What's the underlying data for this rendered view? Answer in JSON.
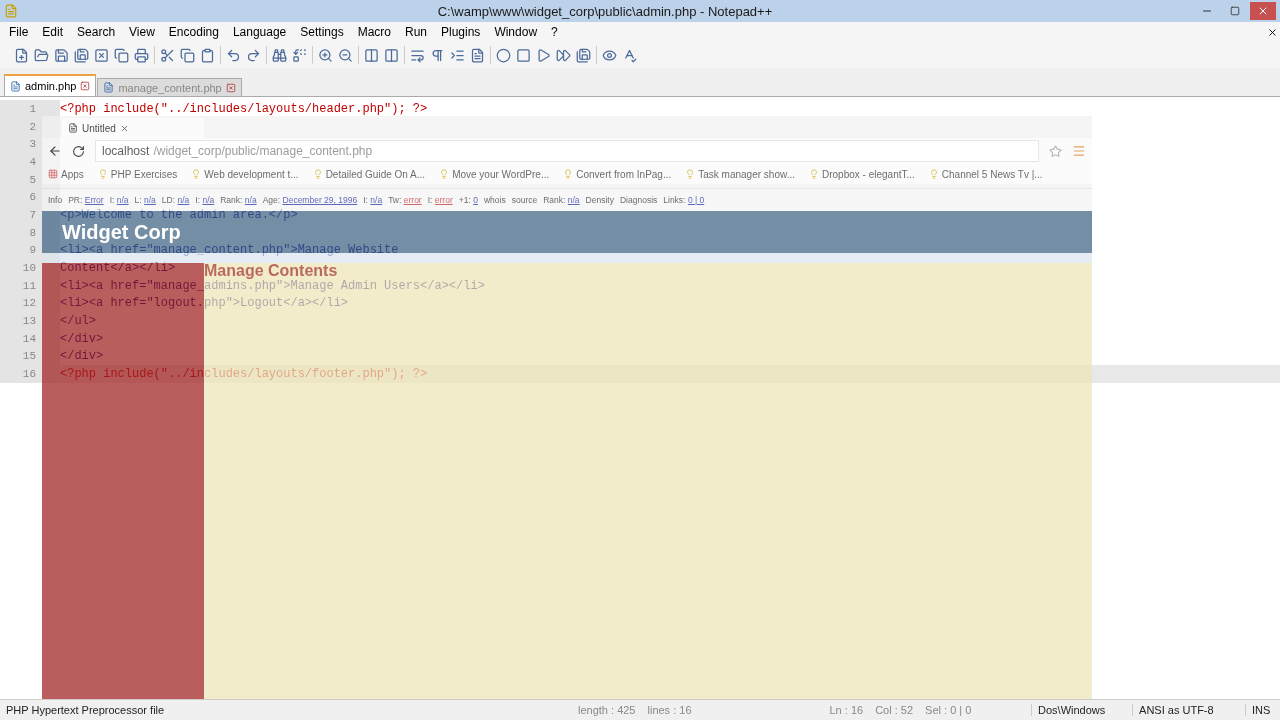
{
  "window": {
    "title": "C:\\wamp\\www\\widget_corp\\public\\admin.php - Notepad++"
  },
  "menu": [
    "File",
    "Edit",
    "Search",
    "View",
    "Encoding",
    "Language",
    "Settings",
    "Macro",
    "Run",
    "Plugins",
    "Window",
    "?"
  ],
  "tabs": [
    {
      "label": "admin.php",
      "selected": true
    },
    {
      "label": "manage_content.php",
      "selected": false
    }
  ],
  "editor": {
    "lines": [
      {
        "number": "1",
        "text": "<?php include(\"../includes/layouts/header.php\"); ?>",
        "kind": "php",
        "current": false
      },
      {
        "number": "2",
        "current": false
      },
      {
        "number": "3",
        "current": false
      },
      {
        "number": "4",
        "current": false
      },
      {
        "number": "5",
        "current": false
      },
      {
        "number": "6",
        "current": false
      },
      {
        "number": "7",
        "text": "<p>Welcome to the admin area.</p>",
        "kind": "html",
        "current": false
      },
      {
        "number": "8",
        "current": false
      },
      {
        "number": "9",
        "text": "<li><a href=\"manage_content.php\">Manage Website",
        "kind": "html",
        "current": false
      },
      {
        "number": "10",
        "text": "Content</a></li>",
        "kind": "html",
        "current": false
      },
      {
        "number": "11",
        "text": "<li><a href=\"manage_admins.php\">Manage Admin Users</a></li>",
        "kind": "html",
        "current": false
      },
      {
        "number": "12",
        "text": "<li><a href=\"logout.php\">Logout</a></li>",
        "kind": "html",
        "current": false
      },
      {
        "number": "13",
        "text": "</ul>",
        "kind": "html",
        "current": false
      },
      {
        "number": "14",
        "text": "</div>",
        "kind": "html",
        "current": false
      },
      {
        "number": "15",
        "text": "</div>",
        "kind": "html",
        "current": false
      },
      {
        "number": "16",
        "text": "<?php include(\"../includes/layouts/footer.php\"); ?>",
        "kind": "php",
        "current": true
      }
    ]
  },
  "browser": {
    "tab": "Untitled",
    "address_host": "localhost",
    "address_path": "/widget_corp/public/manage_content.php",
    "bookmarks": [
      "Apps",
      "PHP Exercises",
      "Web development t...",
      "Detailed Guide On A...",
      "Move your WordPre...",
      "Convert from InPag...",
      "Task manager show...",
      "Dropbox - elegantT...",
      "Channel 5 News Tv |..."
    ],
    "seo_items": [
      {
        "label": "Info",
        "value": ""
      },
      {
        "label": "PR:",
        "value": "Error"
      },
      {
        "label": "I:",
        "value": "n/a"
      },
      {
        "label": "L:",
        "value": "n/a"
      },
      {
        "label": "LD:",
        "value": "n/a"
      },
      {
        "label": "I:",
        "value": "n/a"
      },
      {
        "label": "Rank:",
        "value": "n/a"
      },
      {
        "label": "Age:",
        "value": "December 29, 1996"
      },
      {
        "label": "I:",
        "value": "n/a"
      },
      {
        "label": "Tw:",
        "value": "error"
      },
      {
        "label": "I:",
        "value": "error"
      },
      {
        "label": "+1:",
        "value": "0"
      },
      {
        "label": "whois",
        "value": ""
      },
      {
        "label": "source",
        "value": ""
      },
      {
        "label": "Rank:",
        "value": "n/a"
      },
      {
        "label": "Density",
        "value": ""
      },
      {
        "label": "Diagnosis",
        "value": ""
      },
      {
        "label": "Links:",
        "value": "0 | 0"
      }
    ],
    "page": {
      "site_title": "Widget Corp",
      "heading": "Manage Contents"
    }
  },
  "status_bar": {
    "file_type": "PHP Hypertext Preprocessor file",
    "length": "length : 425",
    "lines": "lines : 16",
    "ln": "Ln : 16",
    "col": "Col : 52",
    "sel": "Sel : 0 | 0",
    "eol": "Dos\\Windows",
    "encoding": "ANSI as UTF-8",
    "mode": "INS"
  }
}
